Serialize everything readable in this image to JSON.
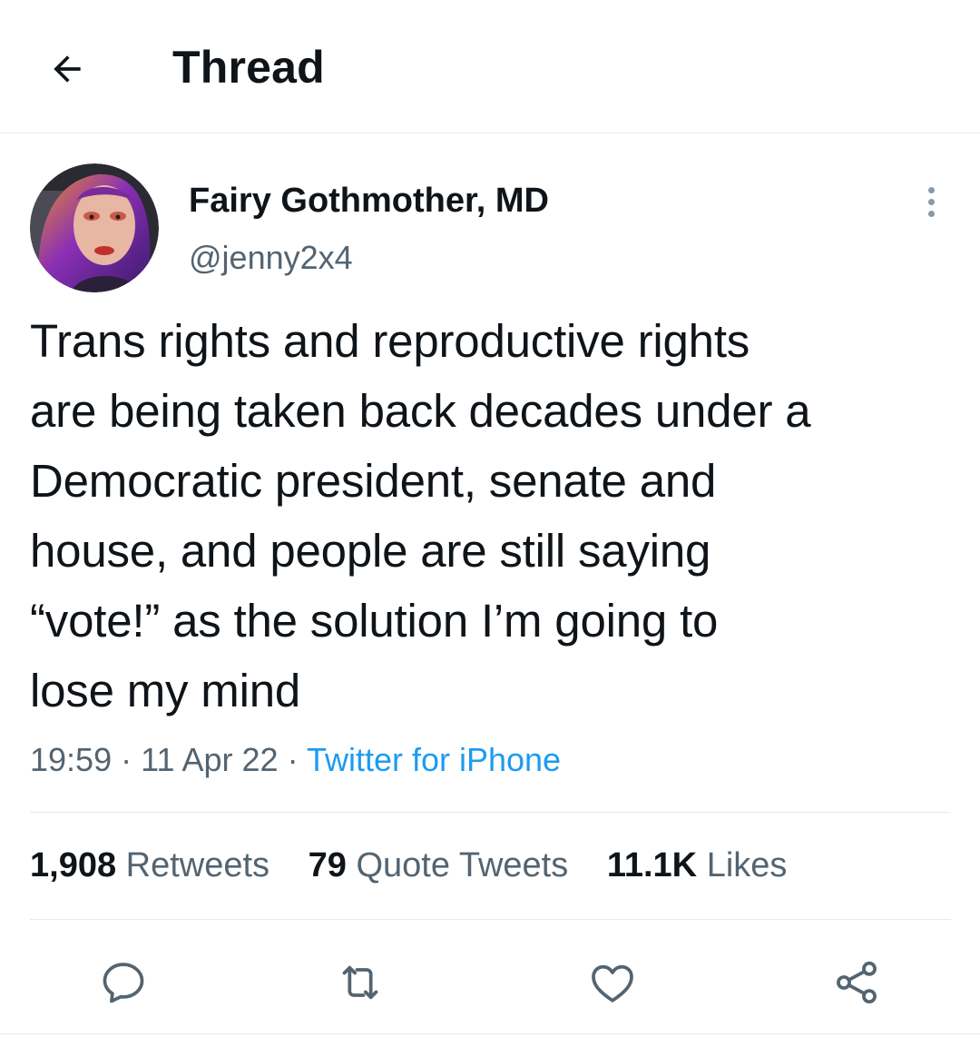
{
  "header": {
    "title": "Thread",
    "back_icon": "arrow-left-icon"
  },
  "tweet": {
    "author": {
      "display_name": "Fairy Gothmother, MD",
      "handle": "@jenny2x4"
    },
    "text_lines": [
      "Trans rights and reproductive rights",
      "are being taken back decades under a",
      "Democratic president, senate and",
      "house, and people are still saying",
      "“vote!” as the solution I’m going to",
      "lose my mind"
    ],
    "time": "19:59",
    "separator": "·",
    "date": "11 Apr 22",
    "source": "Twitter for iPhone",
    "stats": {
      "retweets_count": "1,908",
      "retweets_label": "Retweets",
      "quotes_count": "79",
      "quotes_label": "Quote Tweets",
      "likes_count": "11.1K",
      "likes_label": "Likes"
    }
  },
  "actions": [
    "reply-icon",
    "retweet-icon",
    "like-icon",
    "share-icon"
  ],
  "colors": {
    "text": "#0f1419",
    "secondary": "#536471",
    "link": "#1d9bf0",
    "divider": "#e6e9ec"
  }
}
